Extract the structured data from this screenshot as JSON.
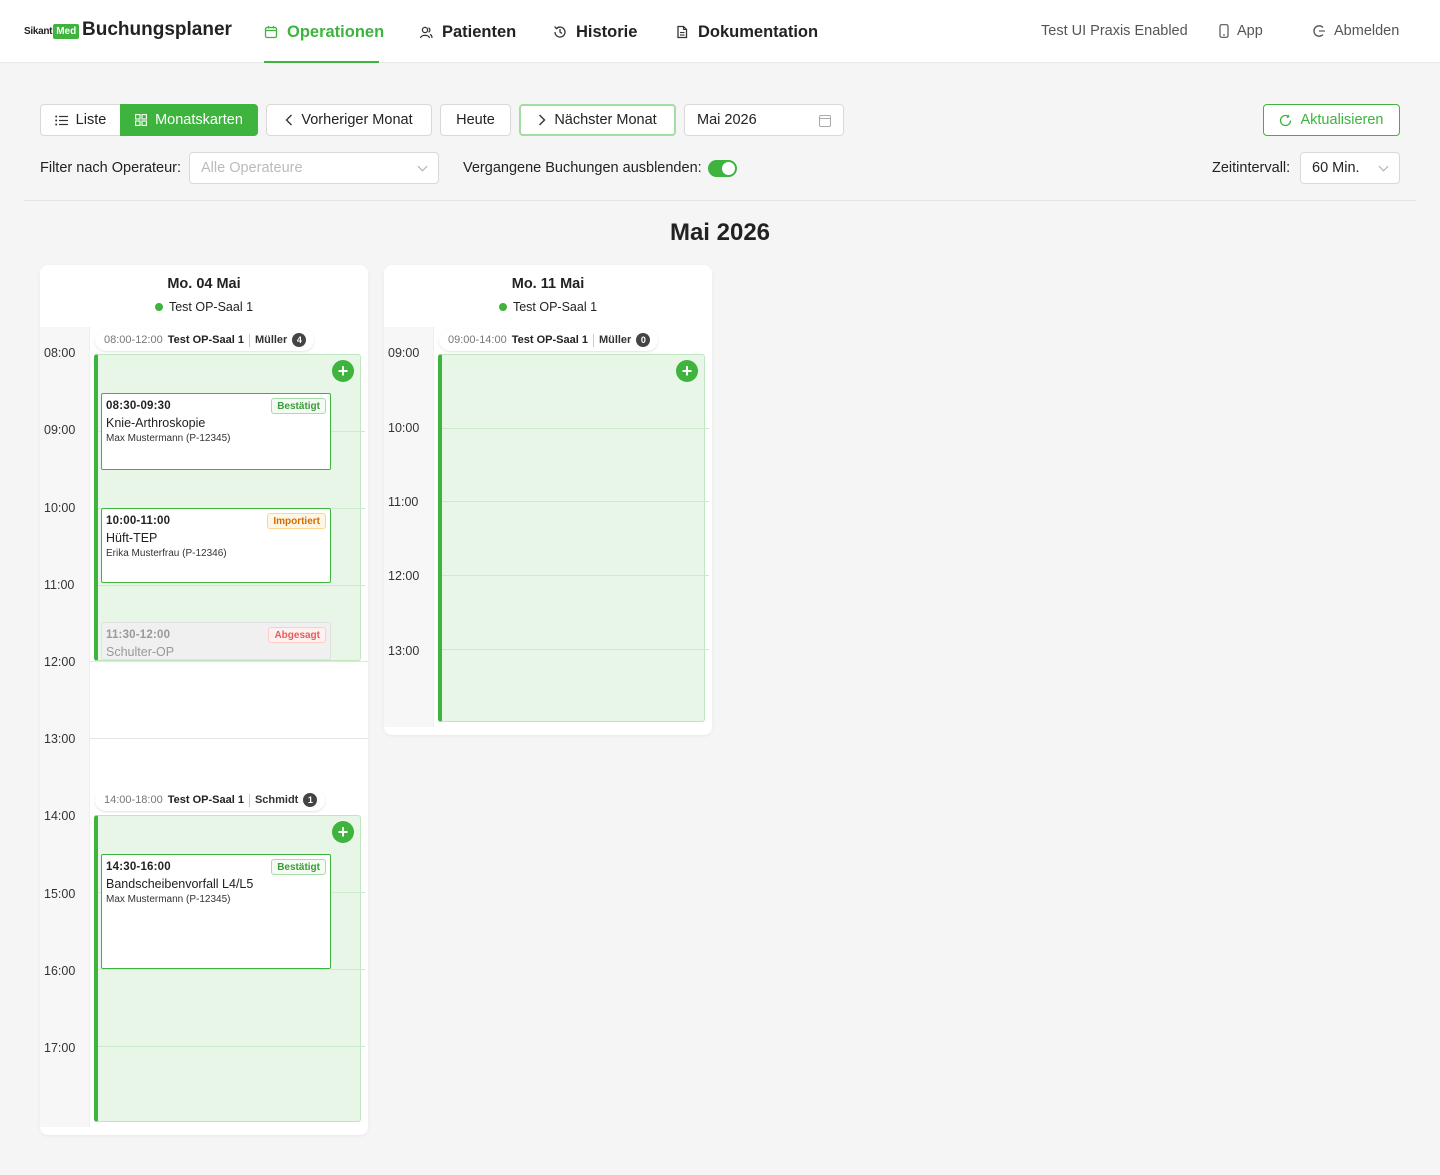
{
  "header": {
    "logo_left": "Sikant",
    "logo_right": "Med",
    "app_title": "Buchungsplaner",
    "nav": [
      {
        "label": "Operationen",
        "icon": "calendar-icon",
        "active": true
      },
      {
        "label": "Patienten",
        "icon": "users-icon",
        "active": false
      },
      {
        "label": "Historie",
        "icon": "history-icon",
        "active": false
      },
      {
        "label": "Dokumentation",
        "icon": "document-icon",
        "active": false
      }
    ],
    "practice": "Test UI Praxis Enabled",
    "app_link": "App",
    "logout": "Abmelden"
  },
  "toolbar": {
    "view_list": "Liste",
    "view_month": "Monatskarten",
    "prev": "Vorheriger Monat",
    "today": "Heute",
    "next": "Nächster Monat",
    "month_value": "Mai 2026",
    "refresh": "Aktualisieren"
  },
  "filters": {
    "operator_label": "Filter nach Operateur:",
    "operator_placeholder": "Alle Operateure",
    "hide_past_label": "Vergangene Buchungen ausblenden:",
    "hide_past_on": true,
    "interval_label": "Zeitintervall:",
    "interval_value": "60 Min."
  },
  "month_title": "Mai 2026",
  "colors": {
    "accent": "#3eb33e",
    "imported": "#d46b08",
    "cancelled": "#e06060"
  },
  "days": [
    {
      "date": "Mo. 04 Mai",
      "room": "Test OP-Saal 1",
      "hours": [
        "08:00",
        "09:00",
        "10:00",
        "11:00",
        "12:00",
        "13:00",
        "14:00",
        "15:00",
        "16:00",
        "17:00"
      ],
      "blocks": [
        {
          "time": "08:00-12:00",
          "room": "Test OP-Saal 1",
          "operator": "Müller",
          "count": "4",
          "appointments": [
            {
              "time": "08:30-09:30",
              "title": "Knie-Arthroskopie",
              "patient": "Max Mustermann (P-12345)",
              "status": "Bestätigt"
            },
            {
              "time": "10:00-11:00",
              "title": "Hüft-TEP",
              "patient": "Erika Musterfrau (P-12346)",
              "status": "Importiert"
            },
            {
              "time": "11:30-12:00",
              "title": "Schulter-OP",
              "patient": "",
              "status": "Abgesagt"
            }
          ]
        },
        {
          "time": "14:00-18:00",
          "room": "Test OP-Saal 1",
          "operator": "Schmidt",
          "count": "1",
          "appointments": [
            {
              "time": "14:30-16:00",
              "title": "Bandscheibenvorfall L4/L5",
              "patient": "Max Mustermann (P-12345)",
              "status": "Bestätigt"
            }
          ]
        }
      ]
    },
    {
      "date": "Mo. 11 Mai",
      "room": "Test OP-Saal 1",
      "hours": [
        "09:00",
        "10:00",
        "11:00",
        "12:00",
        "13:00"
      ],
      "blocks": [
        {
          "time": "09:00-14:00",
          "room": "Test OP-Saal 1",
          "operator": "Müller",
          "count": "0",
          "appointments": []
        }
      ]
    }
  ]
}
